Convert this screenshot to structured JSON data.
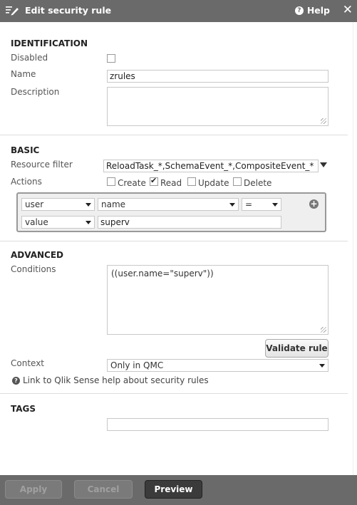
{
  "header": {
    "title": "Edit security rule",
    "help_label": "Help",
    "close_glyph": "✕"
  },
  "identification": {
    "section": "IDENTIFICATION",
    "disabled_label": "Disabled",
    "disabled_checked": false,
    "name_label": "Name",
    "name_value": "zrules",
    "description_label": "Description",
    "description_value": ""
  },
  "basic": {
    "section": "BASIC",
    "resource_filter_label": "Resource filter",
    "resource_filter_value": "ReloadTask_*,SchemaEvent_*,CompositeEvent_*",
    "actions_label": "Actions",
    "actions": [
      {
        "label": "Create",
        "checked": false
      },
      {
        "label": "Read",
        "checked": true
      },
      {
        "label": "Update",
        "checked": false
      },
      {
        "label": "Delete",
        "checked": false
      }
    ],
    "condition_row1": {
      "subject": "user",
      "attribute": "name",
      "operator": "="
    },
    "condition_row2": {
      "type": "value",
      "value": "superv"
    }
  },
  "advanced": {
    "section": "ADVANCED",
    "conditions_label": "Conditions",
    "conditions_value": "((user.name=\"superv\"))",
    "validate_label": "Validate rule",
    "context_label": "Context",
    "context_value": "Only in QMC",
    "help_link": "Link to Qlik Sense help about security rules"
  },
  "tags": {
    "section": "TAGS",
    "value": ""
  },
  "footer": {
    "apply_label": "Apply",
    "cancel_label": "Cancel",
    "preview_label": "Preview"
  },
  "colors": {
    "header_bg": "#6a6a6a",
    "primary_btn": "#3b3b3b"
  }
}
